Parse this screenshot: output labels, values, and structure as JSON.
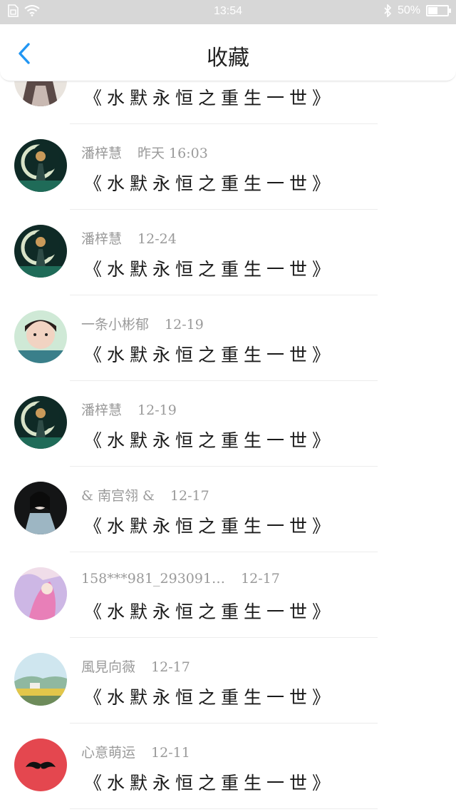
{
  "status_bar": {
    "time": "13:54",
    "battery": "50%",
    "battery_level": 0.5
  },
  "header": {
    "title": "收藏"
  },
  "colors": {
    "accent": "#2196f3",
    "status_bar_bg": "#d7d7d7",
    "meta_text": "#9a9a9a"
  },
  "items": [
    {
      "name": "",
      "date": "",
      "message": "《水默永恒之重生一世》"
    },
    {
      "name": "潘梓慧",
      "date": "昨天 16:03",
      "message": "《水默永恒之重生一世》"
    },
    {
      "name": "潘梓慧",
      "date": "12-24",
      "message": "《水默永恒之重生一世》"
    },
    {
      "name": "一条小彬郁",
      "date": "12-19",
      "message": "《水默永恒之重生一世》"
    },
    {
      "name": "潘梓慧",
      "date": "12-19",
      "message": "《水默永恒之重生一世》"
    },
    {
      "name": "& 南宫翎 &",
      "date": "12-17",
      "message": "《水默永恒之重生一世》"
    },
    {
      "name": "158***981_293091…",
      "date": "12-17",
      "message": "《水默永恒之重生一世》"
    },
    {
      "name": "風見向薇",
      "date": "12-17",
      "message": "《水默永恒之重生一世》"
    },
    {
      "name": "心意萌运",
      "date": "12-11",
      "message": "《水默永恒之重生一世》"
    }
  ]
}
